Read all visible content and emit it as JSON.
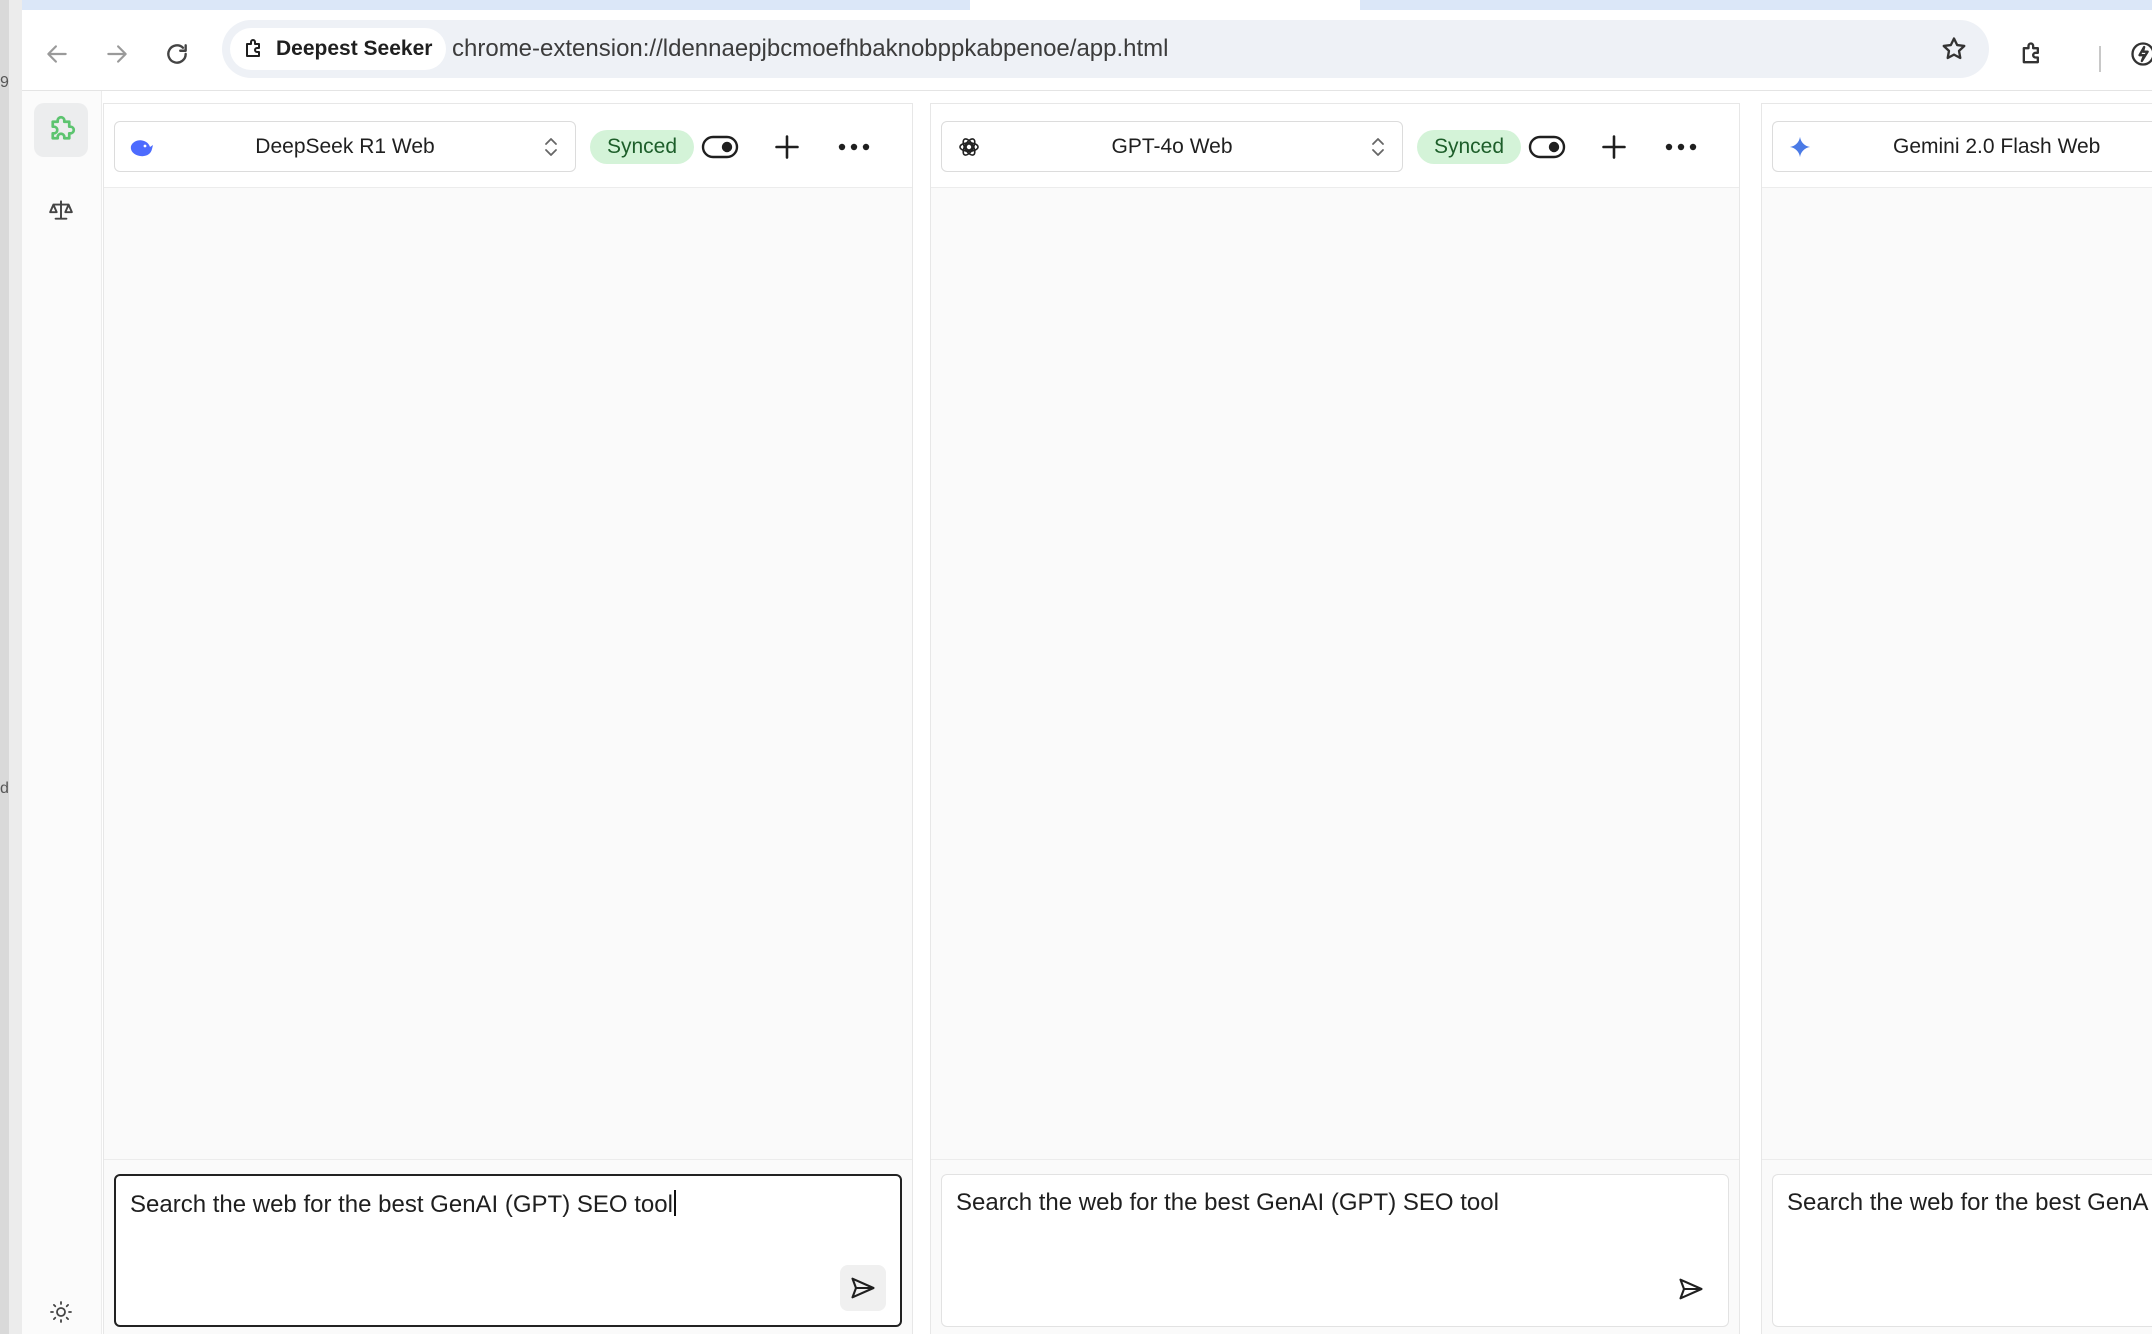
{
  "browser": {
    "site_chip_label": "Deepest Seeker",
    "url": "chrome-extension://ldennaepjbcmoefhbaknobppkabpenoe/app.html",
    "icons": [
      "back-arrow-icon",
      "forward-arrow-icon",
      "reload-icon",
      "extension-puzzle-icon",
      "bookmark-star-icon",
      "extensions-icon",
      "leaf-bolt-icon"
    ]
  },
  "desktop": {
    "marks": [
      "9",
      "d"
    ]
  },
  "sidebar": {
    "items": [
      {
        "name": "puzzle-icon",
        "active": true
      },
      {
        "name": "scale-icon",
        "active": false
      }
    ],
    "bottom_icon": "sun-icon"
  },
  "panes": [
    {
      "model": "DeepSeek R1 Web",
      "logo": "deepseek-whale-icon",
      "status": "Synced",
      "prompt": "Search the web for the best GenAI (GPT) SEO tool",
      "focused": true
    },
    {
      "model": "GPT-4o Web",
      "logo": "openai-icon",
      "status": "Synced",
      "prompt": "Search the web for the best GenAI (GPT) SEO tool",
      "focused": false
    },
    {
      "model": "Gemini 2.0 Flash Web",
      "logo": "gemini-sparkle-icon",
      "prompt": "Search the web for the best GenA",
      "focused": false
    }
  ],
  "colors": {
    "synced_bg": "#d4f3d8",
    "synced_text": "#1d5e2a",
    "active_puzzle": "#5cc46f",
    "gemini_blue": "#4b7be6",
    "deepseek_blue": "#4d6bfe"
  }
}
